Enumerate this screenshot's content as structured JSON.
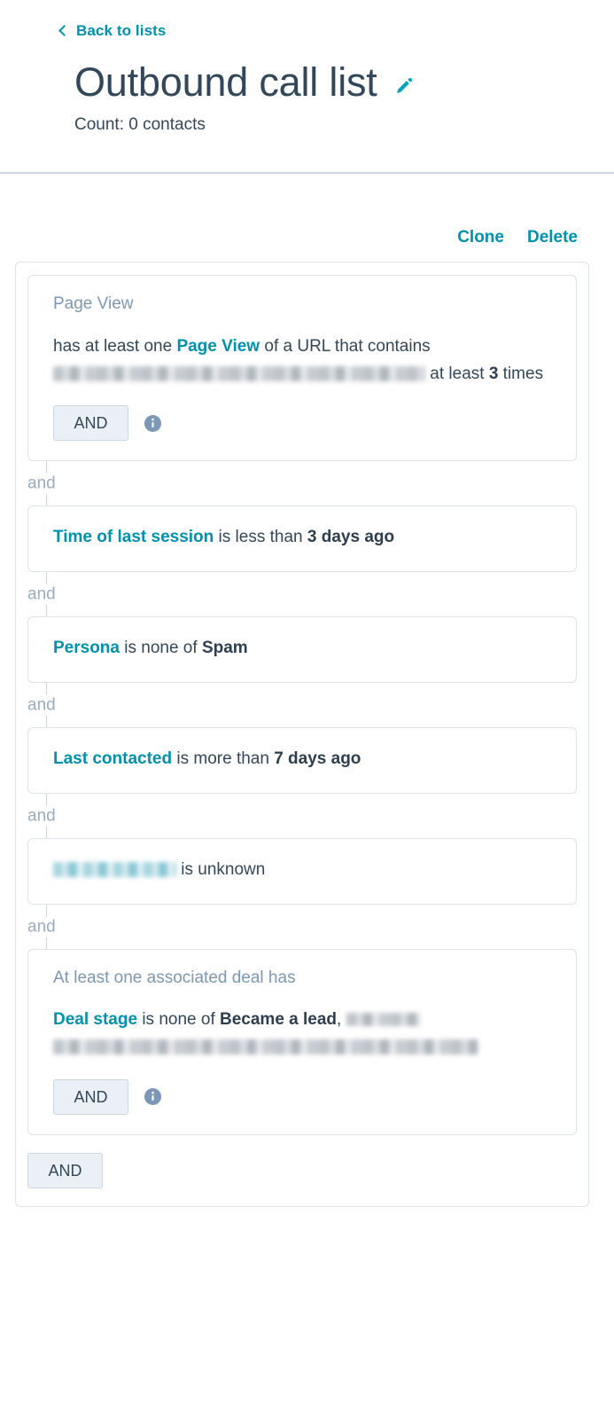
{
  "header": {
    "back_link": "Back to lists",
    "back_icon": "chevron-left-icon",
    "title": "Outbound call list",
    "edit_icon": "pencil-icon",
    "count": "Count: 0 contacts"
  },
  "actions": {
    "clone": "Clone",
    "delete": "Delete"
  },
  "connector_label": "and",
  "and_button_label": "AND",
  "info_icon": "info-icon",
  "filters": [
    {
      "heading": "Page View",
      "segments": [
        {
          "type": "text",
          "value": "has at least one "
        },
        {
          "type": "prop",
          "value": "Page View"
        },
        {
          "type": "text",
          "value": " of a URL that contains "
        },
        {
          "type": "redacted",
          "value": "",
          "style": "r1"
        },
        {
          "type": "text",
          "value": " at least "
        },
        {
          "type": "val",
          "value": "3"
        },
        {
          "type": "text",
          "value": " times"
        }
      ],
      "has_and_row": true
    },
    {
      "heading": "",
      "segments": [
        {
          "type": "prop",
          "value": "Time of last session"
        },
        {
          "type": "text",
          "value": " is less than "
        },
        {
          "type": "val",
          "value": "3 days ago"
        }
      ],
      "has_and_row": false
    },
    {
      "heading": "",
      "segments": [
        {
          "type": "prop",
          "value": "Persona"
        },
        {
          "type": "text",
          "value": " is none of "
        },
        {
          "type": "val",
          "value": "Spam"
        }
      ],
      "has_and_row": false
    },
    {
      "heading": "",
      "segments": [
        {
          "type": "prop",
          "value": "Last contacted"
        },
        {
          "type": "text",
          "value": " is more than "
        },
        {
          "type": "val",
          "value": "7 days ago"
        }
      ],
      "has_and_row": false
    },
    {
      "heading": "",
      "segments": [
        {
          "type": "redacted",
          "value": "",
          "style": "r3 teal"
        },
        {
          "type": "text",
          "value": " is unknown"
        }
      ],
      "has_and_row": false
    },
    {
      "heading": "At least one associated deal has",
      "segments": [
        {
          "type": "prop",
          "value": "Deal stage"
        },
        {
          "type": "text",
          "value": " is none of "
        },
        {
          "type": "val",
          "value": "Became a lead"
        },
        {
          "type": "text",
          "value": ", "
        },
        {
          "type": "redacted",
          "value": "",
          "style": "r2"
        },
        {
          "type": "redacted",
          "value": "",
          "style": "r4"
        }
      ],
      "has_and_row": true
    }
  ]
}
